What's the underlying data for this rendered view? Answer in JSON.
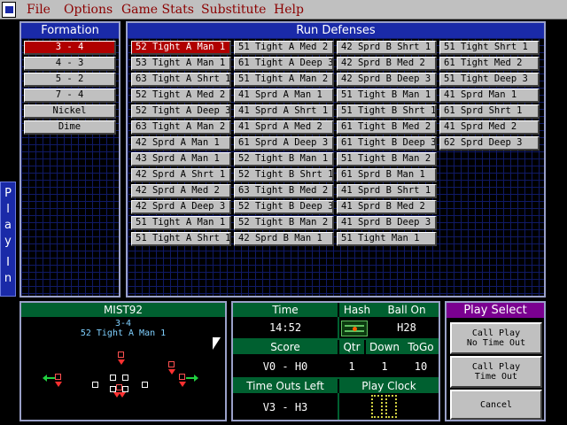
{
  "menu": {
    "items": [
      "File",
      "Options",
      "Game Stats",
      "Substitute",
      "Help"
    ]
  },
  "formation": {
    "title": "Formation",
    "items": [
      "3 - 4",
      "4 - 3",
      "5 - 2",
      "7 - 4",
      "Nickel",
      "Dime"
    ],
    "selected_index": 0
  },
  "run_defenses": {
    "title": "Run Defenses",
    "columns": [
      [
        "52 Tight A Man 1",
        "53 Tight A Man 1",
        "63 Tight A Shrt 1",
        "52 Tight A Med 2",
        "52 Tight A Deep 3",
        "63 Tight A Man 2",
        "42 Sprd A Man 1",
        "43 Sprd A Man 1",
        "42 Sprd A Shrt 1",
        "42 Sprd A Med 2",
        "42 Sprd A Deep 3",
        "51 Tight A Man 1",
        "51 Tight A Shrt 1"
      ],
      [
        "51 Tight A Med 2",
        "61 Tight A Deep 3",
        "51 Tight A Man 2",
        "41 Sprd A Man 1",
        "41 Sprd A Shrt 1",
        "41 Sprd A Med 2",
        "61 Sprd A Deep 3",
        "52 Tight B Man 1",
        "52 Tight B Shrt 1",
        "63 Tight B Med 2",
        "52 Tight B Deep 3",
        "52 Tight B Man 2",
        "42 Sprd B Man 1"
      ],
      [
        "42 Sprd B Shrt 1",
        "42 Sprd B Med 2",
        "42 Sprd B Deep 3",
        "51 Tight B Man 1",
        "51 Tight B Shrt 1",
        "61 Tight B Med 2",
        "61 Tight B Deep 3",
        "51 Tight B Man 2",
        "61 Sprd B Man 1",
        "41 Sprd B Shrt 1",
        "41 Sprd B Med 2",
        "41 Sprd B Deep 3",
        "51 Tight Man 1"
      ],
      [
        "51 Tight Shrt 1",
        "61 Tight Med 2",
        "51 Tight Deep 3",
        "41 Sprd Man 1",
        "61 Sprd Shrt 1",
        "41 Sprd Med 2",
        "62 Sprd Deep 3"
      ]
    ],
    "selected": "52 Tight A Man 1"
  },
  "play_in": {
    "label": [
      "P",
      "l",
      "a",
      "y",
      "I",
      "n"
    ]
  },
  "field": {
    "team": "MIST92",
    "formation": "3-4",
    "play": "52 Tight A Man 1"
  },
  "stats": {
    "time_label": "Time",
    "time_value": "14:52",
    "hash_label": "Hash",
    "ball_on_label": "Ball On",
    "ball_on_value": "H28",
    "score_label": "Score",
    "score_value": "V0 - H0",
    "qtr_label": "Qtr",
    "qtr_value": "1",
    "down_label": "Down",
    "down_value": "1",
    "togo_label": "ToGo",
    "togo_value": "10",
    "timeouts_label": "Time Outs Left",
    "timeouts_value": "V3 - H3",
    "play_clock_label": "Play Clock",
    "colors": {
      "header_green": "#006030"
    }
  },
  "play_select": {
    "title": "Play Select",
    "call_no_timeout": [
      "Call Play",
      "No Time Out"
    ],
    "call_timeout": [
      "Call Play",
      "Time Out"
    ],
    "cancel": "Cancel"
  },
  "colors": {
    "title_blue": "#1a2aa8",
    "selected_red": "#b00000",
    "menu_text": "#8b0000",
    "play_select_purple": "#7a0090"
  }
}
